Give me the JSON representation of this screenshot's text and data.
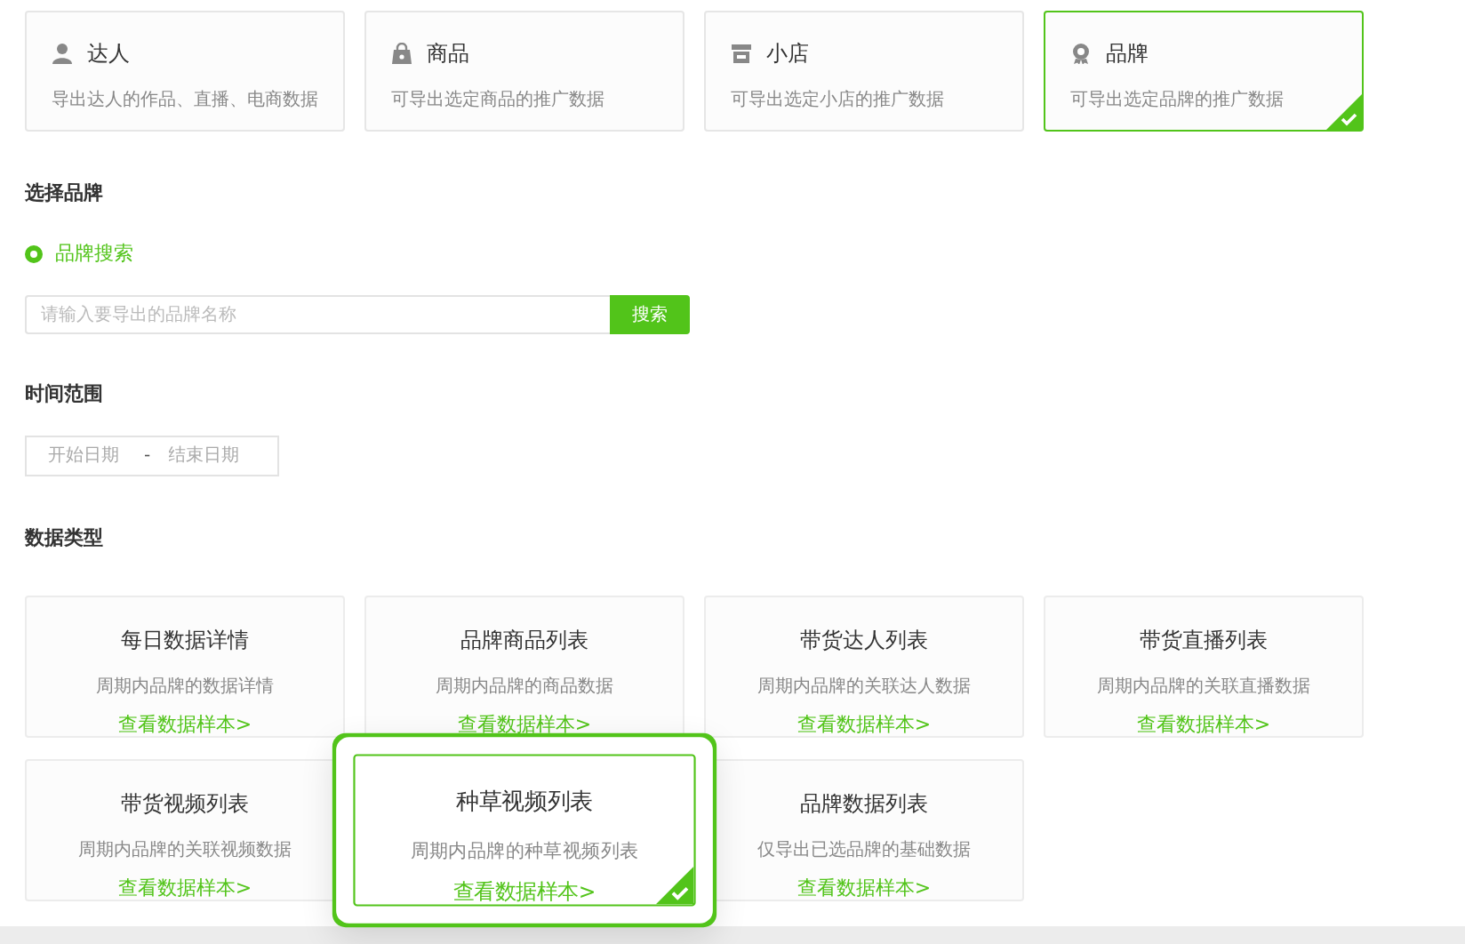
{
  "export_targets": [
    {
      "title": "达人",
      "description": "导出达人的作品、直播、电商数据",
      "selected": false
    },
    {
      "title": "商品",
      "description": "可导出选定商品的推广数据",
      "selected": false
    },
    {
      "title": "小店",
      "description": "可导出选定小店的推广数据",
      "selected": false
    },
    {
      "title": "品牌",
      "description": "可导出选定品牌的推广数据",
      "selected": true
    }
  ],
  "brand_section": {
    "heading": "选择品牌",
    "radio": {
      "label": "品牌搜索",
      "selected": true
    },
    "search": {
      "placeholder": "请输入要导出的品牌名称",
      "button": "搜索"
    }
  },
  "time_range": {
    "heading": "时间范围",
    "start_placeholder": "开始日期",
    "separator": "-",
    "end_placeholder": "结束日期"
  },
  "data_types": {
    "heading": "数据类型",
    "items": [
      {
        "title": "每日数据详情",
        "description": "周期内品牌的数据详情",
        "link": "查看数据样本>",
        "selected": false
      },
      {
        "title": "品牌商品列表",
        "description": "周期内品牌的商品数据",
        "link": "查看数据样本>",
        "selected": false
      },
      {
        "title": "带货达人列表",
        "description": "周期内品牌的关联达人数据",
        "link": "查看数据样本>",
        "selected": false
      },
      {
        "title": "带货直播列表",
        "description": "周期内品牌的关联直播数据",
        "link": "查看数据样本>",
        "selected": false
      },
      {
        "title": "带货视频列表",
        "description": "周期内品牌的关联视频数据",
        "link": "查看数据样本>",
        "selected": false
      },
      {
        "title": "种草视频列表",
        "description": "周期内品牌的种草视频列表",
        "link": "查看数据样本>",
        "selected": true
      },
      {
        "title": "品牌数据列表",
        "description": "仅导出已选品牌的基础数据",
        "link": "查看数据样本>",
        "selected": false
      }
    ]
  }
}
